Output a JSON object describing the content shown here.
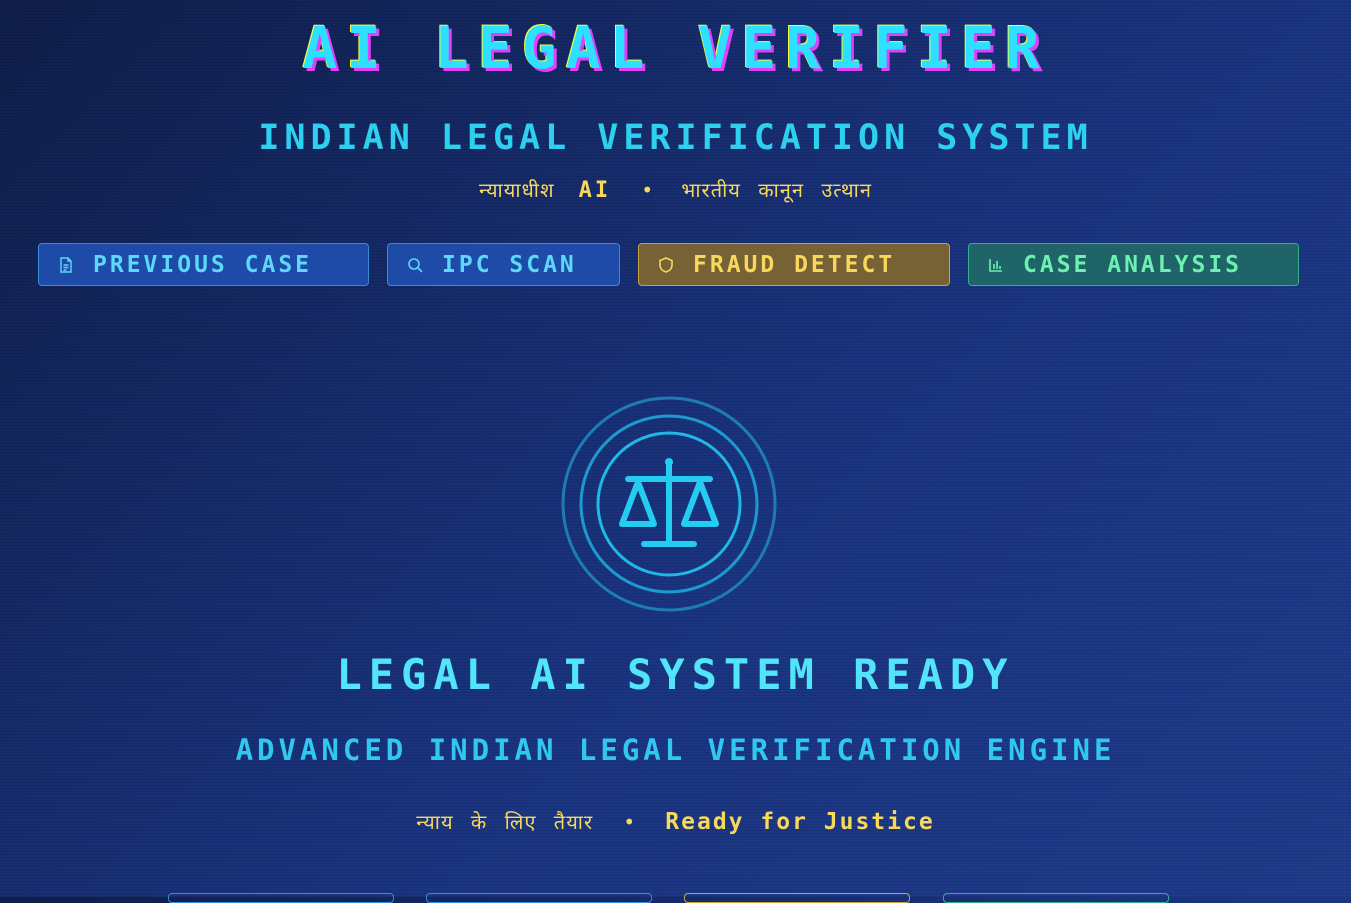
{
  "header": {
    "title": "AI LEGAL VERIFIER",
    "subtitle": "INDIAN LEGAL VERIFICATION SYSTEM",
    "tagline": {
      "hindi_left": "न्यायाधीश",
      "ai": "AI",
      "separator": "•",
      "hindi_right": "भारतीय कानून उत्थान"
    }
  },
  "actions": [
    {
      "label": "PREVIOUS CASE",
      "icon": "document-icon"
    },
    {
      "label": "IPC SCAN",
      "icon": "search-icon"
    },
    {
      "label": "FRAUD DETECT",
      "icon": "shield-icon"
    },
    {
      "label": "CASE ANALYSIS",
      "icon": "bar-chart-icon"
    }
  ],
  "status": {
    "emblem_icon": "scales-of-justice-icon",
    "heading": "LEGAL AI SYSTEM READY",
    "subheading": "ADVANCED INDIAN LEGAL VERIFICATION ENGINE",
    "hindi": "न्याय के लिए तैयार",
    "separator": "•",
    "english": "Ready for Justice"
  },
  "colors": {
    "background": "#1a3480",
    "accent_cyan": "#2ee0ff",
    "accent_yellow": "#f8d85a",
    "accent_green": "#6ef0b0",
    "accent_magenta": "#e040fb"
  }
}
